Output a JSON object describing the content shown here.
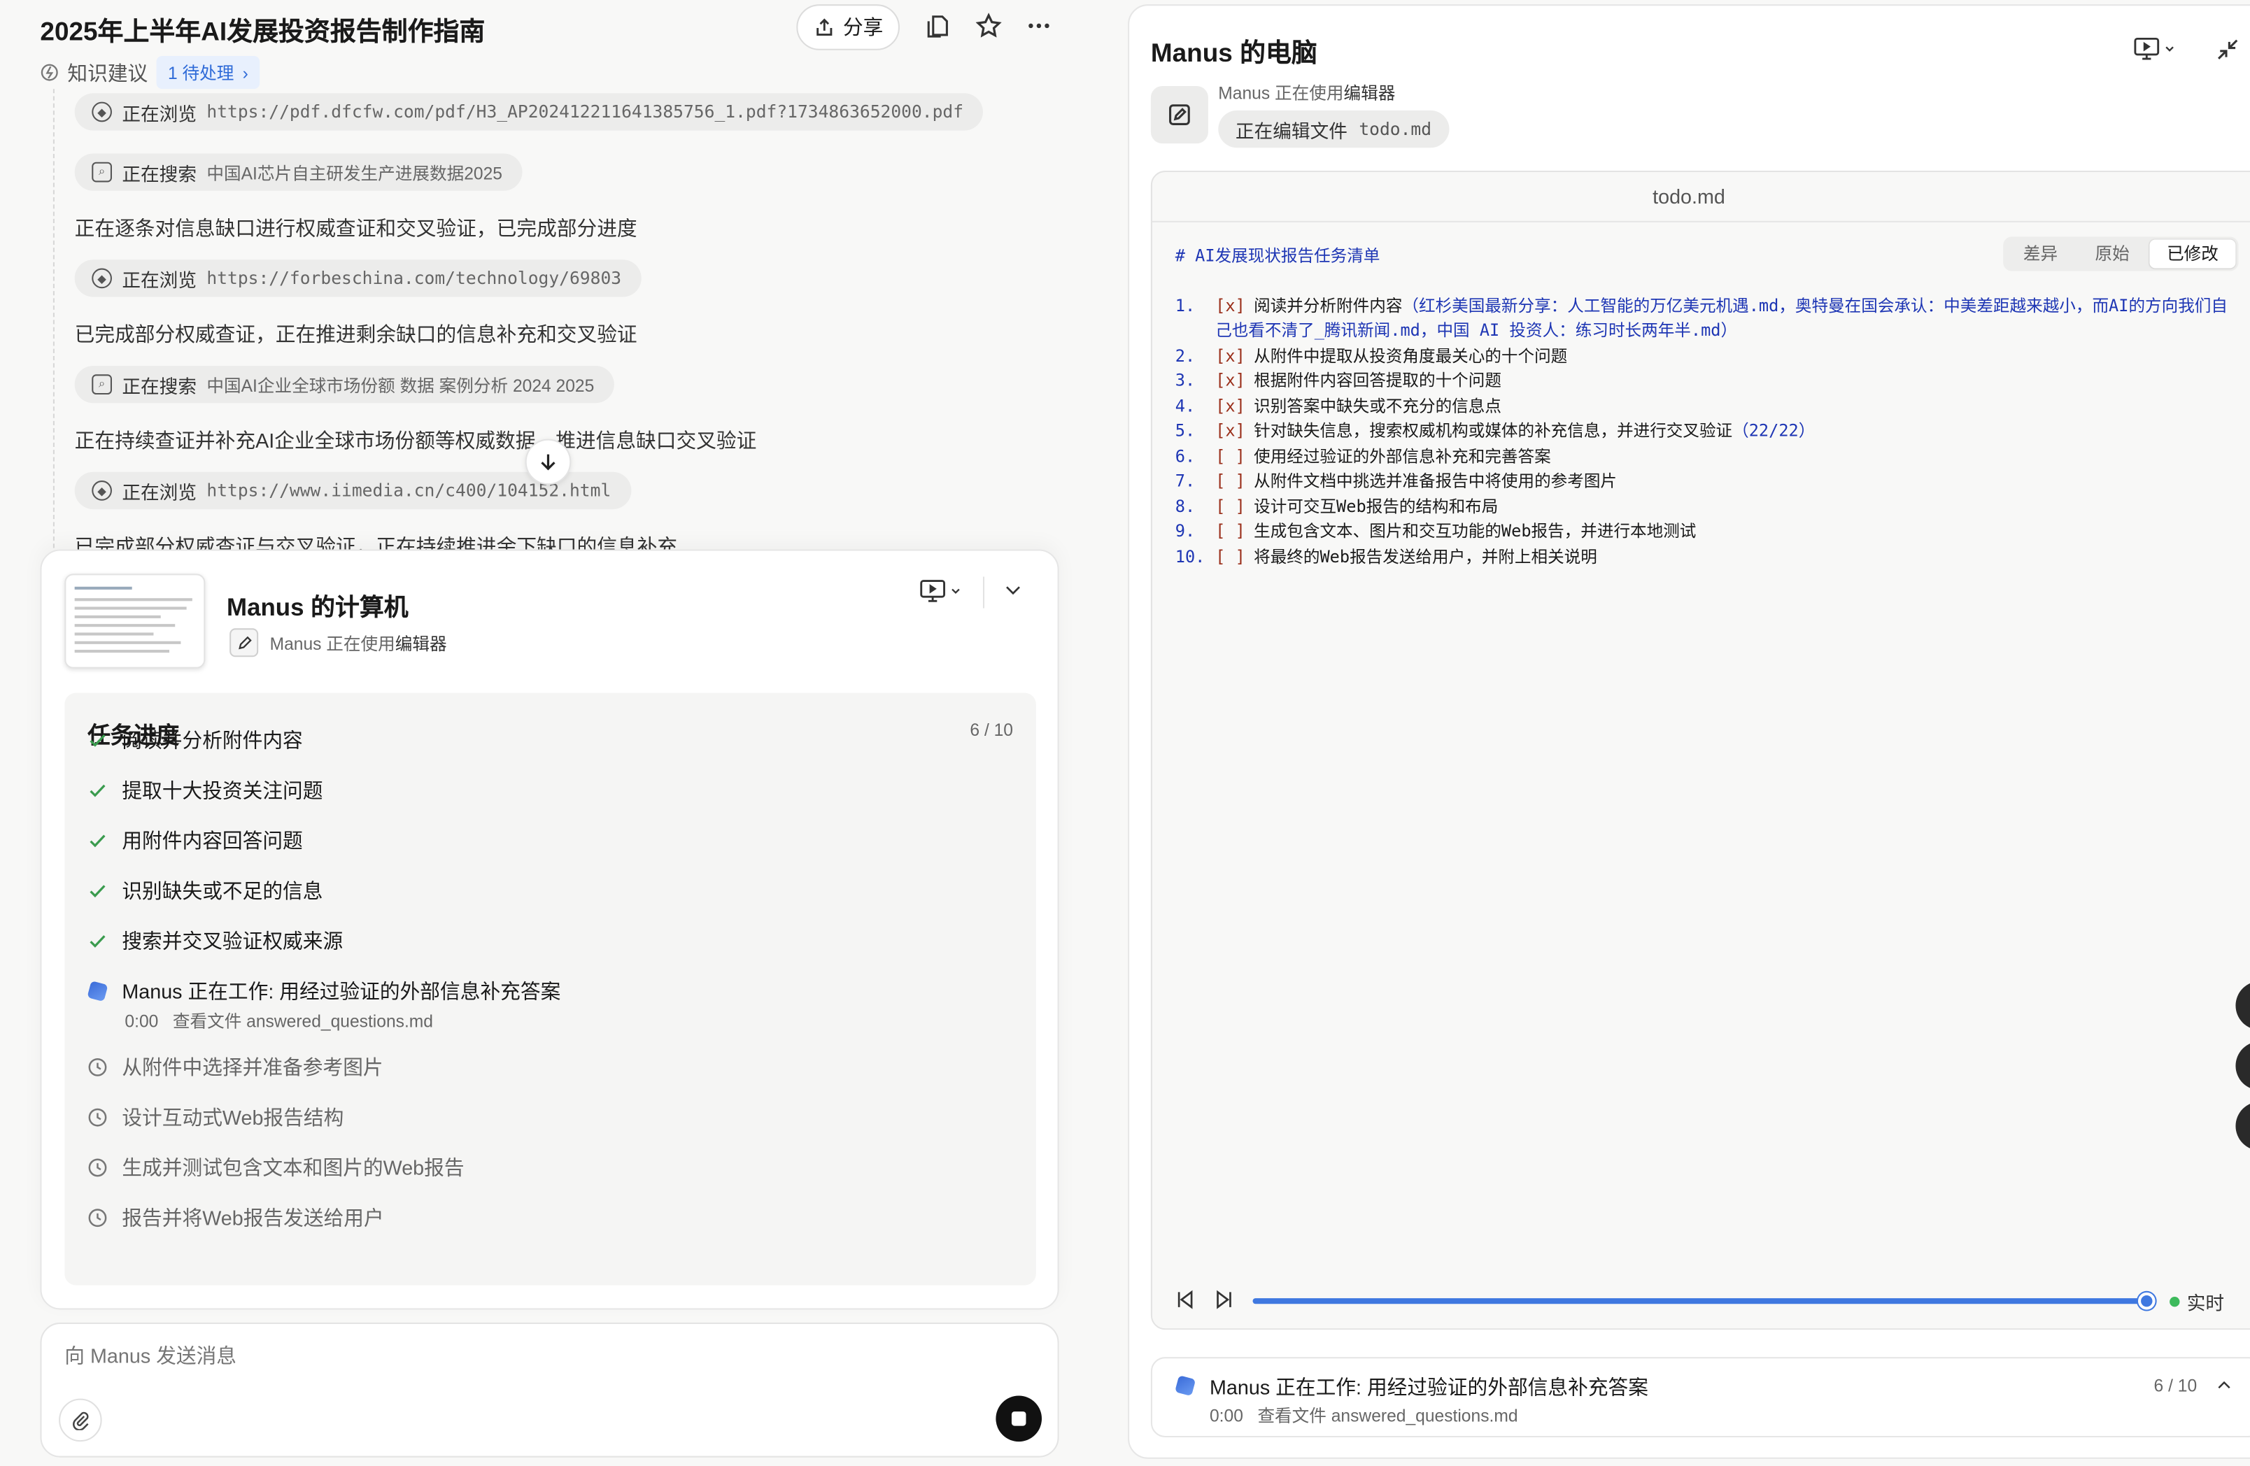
{
  "left": {
    "title": "2025年上半年AI发展投资报告制作指南",
    "share_label": "分享",
    "knowledge_label": "知识建议",
    "pending_label": "1 待处理",
    "activity": [
      {
        "kind": "chip",
        "action": "正在浏览",
        "value": "https://pdf.dfcfw.com/pdf/H3_AP202412211641385756_1.pdf?1734863652000.pdf",
        "icon": "compass-icon"
      },
      {
        "kind": "chip",
        "action": "正在搜索",
        "value": "中国AI芯片自主研发生产进展数据2025",
        "icon": "search-icon"
      },
      {
        "kind": "text",
        "text": "正在逐条对信息缺口进行权威查证和交叉验证，已完成部分进度"
      },
      {
        "kind": "chip",
        "action": "正在浏览",
        "value": "https://forbeschina.com/technology/69803",
        "icon": "compass-icon"
      },
      {
        "kind": "text",
        "text": "已完成部分权威查证，正在推进剩余缺口的信息补充和交叉验证"
      },
      {
        "kind": "chip",
        "action": "正在搜索",
        "value": "中国AI企业全球市场份额 数据 案例分析 2024 2025",
        "icon": "search-icon"
      },
      {
        "kind": "text",
        "text": "正在持续查证并补充AI企业全球市场份额等权威数据，推进信息缺口交叉验证"
      },
      {
        "kind": "chip",
        "action": "正在浏览",
        "value": "https://www.iimedia.cn/c400/104152.html",
        "icon": "compass-icon"
      },
      {
        "kind": "text",
        "text": "已完成部分权威查证与交叉验证，正在持续推进余下缺口的信息补充"
      }
    ],
    "computer_card": {
      "title": "Manus 的计算机",
      "sub_prefix": "Manus 正在使用",
      "sub_tool": "编辑器",
      "progress_title": "任务进度",
      "progress_count": "6 / 10",
      "progress_value": 0.6,
      "tasks": [
        {
          "label": "阅读并分析附件内容",
          "status": "done"
        },
        {
          "label": "提取十大投资关注问题",
          "status": "done"
        },
        {
          "label": "用附件内容回答问题",
          "status": "done"
        },
        {
          "label": "识别缺失或不足的信息",
          "status": "done"
        },
        {
          "label": "搜索并交叉验证权威来源",
          "status": "done"
        },
        {
          "label": "Manus 正在工作: 用经过验证的外部信息补充答案",
          "status": "working",
          "sub_time": "0:00",
          "sub_text": "查看文件 answered_questions.md"
        },
        {
          "label": "从附件中选择并准备参考图片",
          "status": "pending"
        },
        {
          "label": "设计互动式Web报告结构",
          "status": "pending"
        },
        {
          "label": "生成并测试包含文本和图片的Web报告",
          "status": "pending"
        },
        {
          "label": "报告并将Web报告发送给用户",
          "status": "pending"
        }
      ]
    },
    "input_placeholder": "向 Manus 发送消息"
  },
  "right": {
    "title": "Manus 的电脑",
    "using_prefix": "Manus 正在使用",
    "using_tool": "编辑器",
    "editing_label": "正在编辑文件",
    "editing_file": "todo.md",
    "editor_filename": "todo.md",
    "view_modes": [
      "差异",
      "原始",
      "已修改"
    ],
    "active_view_mode": "已修改",
    "doc_heading": "# AI发展现状报告任务清单",
    "todo_items": [
      {
        "num": "1.",
        "box": "[x]",
        "text": "阅读并分析附件内容",
        "paren": "（红杉美国最新分享：人工智能的万亿美元机遇.md，奥特曼在国会承认：中美差距越来越小，而AI的方向我们自己也看不清了_腾讯新闻.md，中国 AI 投资人：练习时长两年半.md）"
      },
      {
        "num": "2.",
        "box": "[x]",
        "text": "从附件中提取从投资角度最关心的十个问题",
        "paren": ""
      },
      {
        "num": "3.",
        "box": "[x]",
        "text": "根据附件内容回答提取的十个问题",
        "paren": ""
      },
      {
        "num": "4.",
        "box": "[x]",
        "text": "识别答案中缺失或不充分的信息点",
        "paren": ""
      },
      {
        "num": "5.",
        "box": "[x]",
        "text": "针对缺失信息，搜索权威机构或媒体的补充信息，并进行交叉验证",
        "paren": "（22/22）"
      },
      {
        "num": "6.",
        "box": "[ ]",
        "text": "使用经过验证的外部信息补充和完善答案",
        "paren": ""
      },
      {
        "num": "7.",
        "box": "[ ]",
        "text": "从附件文档中挑选并准备报告中将使用的参考图片",
        "paren": ""
      },
      {
        "num": "8.",
        "box": "[ ]",
        "text": "设计可交互Web报告的结构和布局",
        "paren": ""
      },
      {
        "num": "9.",
        "box": "[ ]",
        "text": "生成包含文本、图片和交互功能的Web报告，并进行本地测试",
        "paren": ""
      },
      {
        "num": "10.",
        "box": "[ ]",
        "text": "将最终的Web报告发送给用户，并附上相关说明",
        "paren": ""
      }
    ],
    "player": {
      "live_label": "实时",
      "position": 1.0
    },
    "footer": {
      "title": "Manus 正在工作: 用经过验证的外部信息补充答案",
      "time": "0:00",
      "sub_text": "查看文件 answered_questions.md",
      "count": "6 / 10"
    }
  },
  "colors": {
    "accent": "#3f78e0",
    "done_check": "#3a9b4e",
    "live_dot": "#3dba5c",
    "link_blue": "#2f6bd8"
  }
}
